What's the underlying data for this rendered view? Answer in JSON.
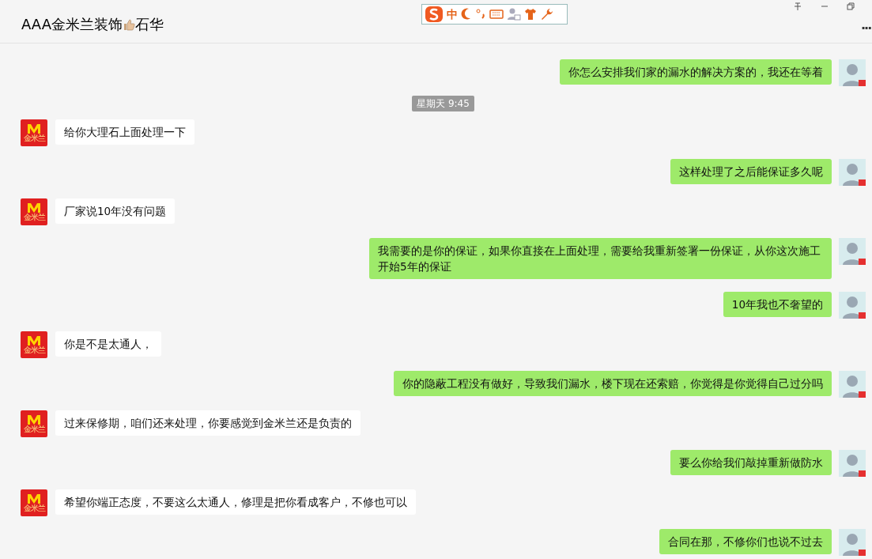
{
  "window": {
    "title_before_icon": "AAA金米兰装饰",
    "title_after_icon": "石华",
    "more": "..."
  },
  "ime_toolbar": {
    "mode": "中"
  },
  "messages": [
    {
      "kind": "sent",
      "text": "你怎么安排我们家的漏水的解决方案的，我还在等着"
    },
    {
      "kind": "time",
      "text": "星期天 9:45"
    },
    {
      "kind": "received",
      "text": "给你大理石上面处理一下",
      "avatar_text": "金米兰"
    },
    {
      "kind": "sent",
      "text": "这样处理了之后能保证多久呢"
    },
    {
      "kind": "received",
      "text": "厂家说10年没有问题",
      "avatar_text": "金米兰"
    },
    {
      "kind": "sent",
      "text": "我需要的是你的保证，如果你直接在上面处理，需要给我重新签署一份保证，从你这次施工开始5年的保证"
    },
    {
      "kind": "sent",
      "text": "10年我也不奢望的"
    },
    {
      "kind": "received",
      "text": "你是不是太通人，",
      "avatar_text": "金米兰"
    },
    {
      "kind": "sent",
      "text": "你的隐蔽工程没有做好，导致我们漏水，楼下现在还索赔，你觉得是你觉得自己过分吗"
    },
    {
      "kind": "received",
      "text": "过来保修期，咱们还来处理，你要感觉到金米兰还是负责的",
      "avatar_text": "金米兰"
    },
    {
      "kind": "sent",
      "text": "要么你给我们敲掉重新做防水"
    },
    {
      "kind": "received",
      "text": "希望你端正态度，不要这么太通人，修理是把你看成客户，不修也可以",
      "avatar_text": "金米兰"
    },
    {
      "kind": "sent",
      "text": "合同在那，不修你们也说不过去"
    }
  ]
}
